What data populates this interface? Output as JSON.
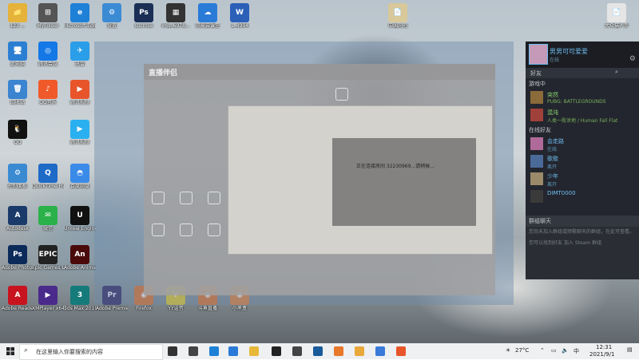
{
  "desktop_icons": [
    {
      "label": "123 ...",
      "color": "#e5b33a",
      "glyph": "📁"
    },
    {
      "label": "MyFolder",
      "color": "#555",
      "glyph": "⊞"
    },
    {
      "label": "Microsoft Edge",
      "color": "#1e80d6",
      "glyph": "e"
    },
    {
      "label": "设置",
      "color": "#3b8bd4",
      "glyph": "⚙"
    },
    {
      "label": "sucrose",
      "color": "#1b2f56",
      "glyph": "Ps"
    },
    {
      "label": "img_6978...",
      "color": "#333",
      "glyph": "▦"
    },
    {
      "label": "网易云课堂",
      "color": "#2a7bd8",
      "glyph": "☁"
    },
    {
      "label": "1_4994",
      "color": "#2b5fb8",
      "glyph": "W"
    },
    {
      "label": "此电脑",
      "color": "#2b7fd3",
      "glyph": "🖥"
    },
    {
      "label": "腾讯会议",
      "color": "#1478e6",
      "glyph": "◎"
    },
    {
      "label": "迅雷",
      "color": "#2a9ee8",
      "glyph": "✈"
    },
    {
      "label": "回收站",
      "color": "#3a84d0",
      "glyph": "🗑"
    },
    {
      "label": "QQ音乐",
      "color": "#f05a2a",
      "glyph": "♪"
    },
    {
      "label": "腾讯视频",
      "color": "#e8552a",
      "glyph": "▶"
    },
    {
      "label": "QQ",
      "color": "#111",
      "glyph": "🐧"
    },
    {
      "label": "腾讯视频",
      "color": "#2ab0f0",
      "glyph": "▶"
    },
    {
      "label": "控制面板",
      "color": "#3a8ad2",
      "glyph": "⚙"
    },
    {
      "label": "QuickTime Player",
      "color": "#1e6ac7",
      "glyph": "Q"
    },
    {
      "label": "百度网盘",
      "color": "#3a8ae8",
      "glyph": "◓"
    },
    {
      "label": "Autodesk",
      "color": "#1a3a6a",
      "glyph": "A"
    },
    {
      "label": "微信",
      "color": "#2bb14a",
      "glyph": "✉"
    },
    {
      "label": "Unreal Engine",
      "color": "#111",
      "glyph": "U"
    },
    {
      "label": "Adobe Photoshop",
      "color": "#0b2a5a",
      "glyph": "Ps"
    },
    {
      "label": "Epic Games Launcher",
      "color": "#222",
      "glyph": "EPIC"
    },
    {
      "label": "Adobe Animate",
      "color": "#4a0a0a",
      "glyph": "An"
    },
    {
      "label": "Adobe Reader XI",
      "color": "#c8141e",
      "glyph": "A"
    },
    {
      "label": "XMPlayer x64",
      "color": "#4a2a8a",
      "glyph": "▶"
    },
    {
      "label": "3ds Max 2019",
      "color": "#157a7a",
      "glyph": "3"
    },
    {
      "label": "Adobe Premiere",
      "color": "#2a1a5a",
      "glyph": "Pr"
    },
    {
      "label": "Firefox",
      "color": "#e86a1a",
      "glyph": "◉"
    },
    {
      "label": "YY语音",
      "color": "#e8c81a",
      "glyph": "Y"
    },
    {
      "label": "斗鱼直播",
      "color": "#e86a1a",
      "glyph": "◉"
    },
    {
      "label": "小黑盒",
      "color": "#e8782a",
      "glyph": "◉"
    },
    {
      "label": "中国网吧",
      "color": "#d8c89a",
      "glyph": "📄"
    },
    {
      "label": "大众猫人手",
      "color": "#e5e5e5",
      "glyph": "📄"
    }
  ],
  "live_window": {
    "brand": "直播伴侣",
    "connecting_text": "正在连接房间 32230969...请稍候..."
  },
  "steam": {
    "username": "男男可可爱爱",
    "status": "在线",
    "friends_label": "好友",
    "ingame_header": "游戏中",
    "ingame": [
      {
        "name": "突然",
        "game": "PUBG: BATTLEGROUNDS",
        "color": "#8b6b3a"
      },
      {
        "name": "混沌",
        "game": "人类一败涂地 / Human Fall Flat",
        "color": "#a0403a"
      }
    ],
    "online_header": "在线好友",
    "online": [
      {
        "name": "会走路",
        "status": "在线",
        "color": "#b06a9a"
      },
      {
        "name": "歌歌",
        "status": "离开",
        "color": "#4a6a9a"
      },
      {
        "name": "少年",
        "status": "离开",
        "color": "#9a8a6a"
      },
      {
        "name": "DIMT0000",
        "status": "",
        "color": "#3a3a3a"
      }
    ],
    "group_header": "群组聊天",
    "group_text": "您尚未加入群组或频繁聊天的群组，在此可查看。",
    "group_join_text": "您可以找到好友 加入 Steam 群组"
  },
  "taskbar": {
    "search_placeholder": "在这里输入你要搜索的内容",
    "weather": "27°C",
    "time": "12:31",
    "date": "2021/9/1",
    "lang": "中",
    "colors": [
      "#333",
      "#444",
      "#1e80d6",
      "#2a7bd8",
      "#e8b83a",
      "#222",
      "#444",
      "#1a5a9a",
      "#e8782a",
      "#e8a83a",
      "#3a7ad8",
      "#e8552a"
    ]
  }
}
